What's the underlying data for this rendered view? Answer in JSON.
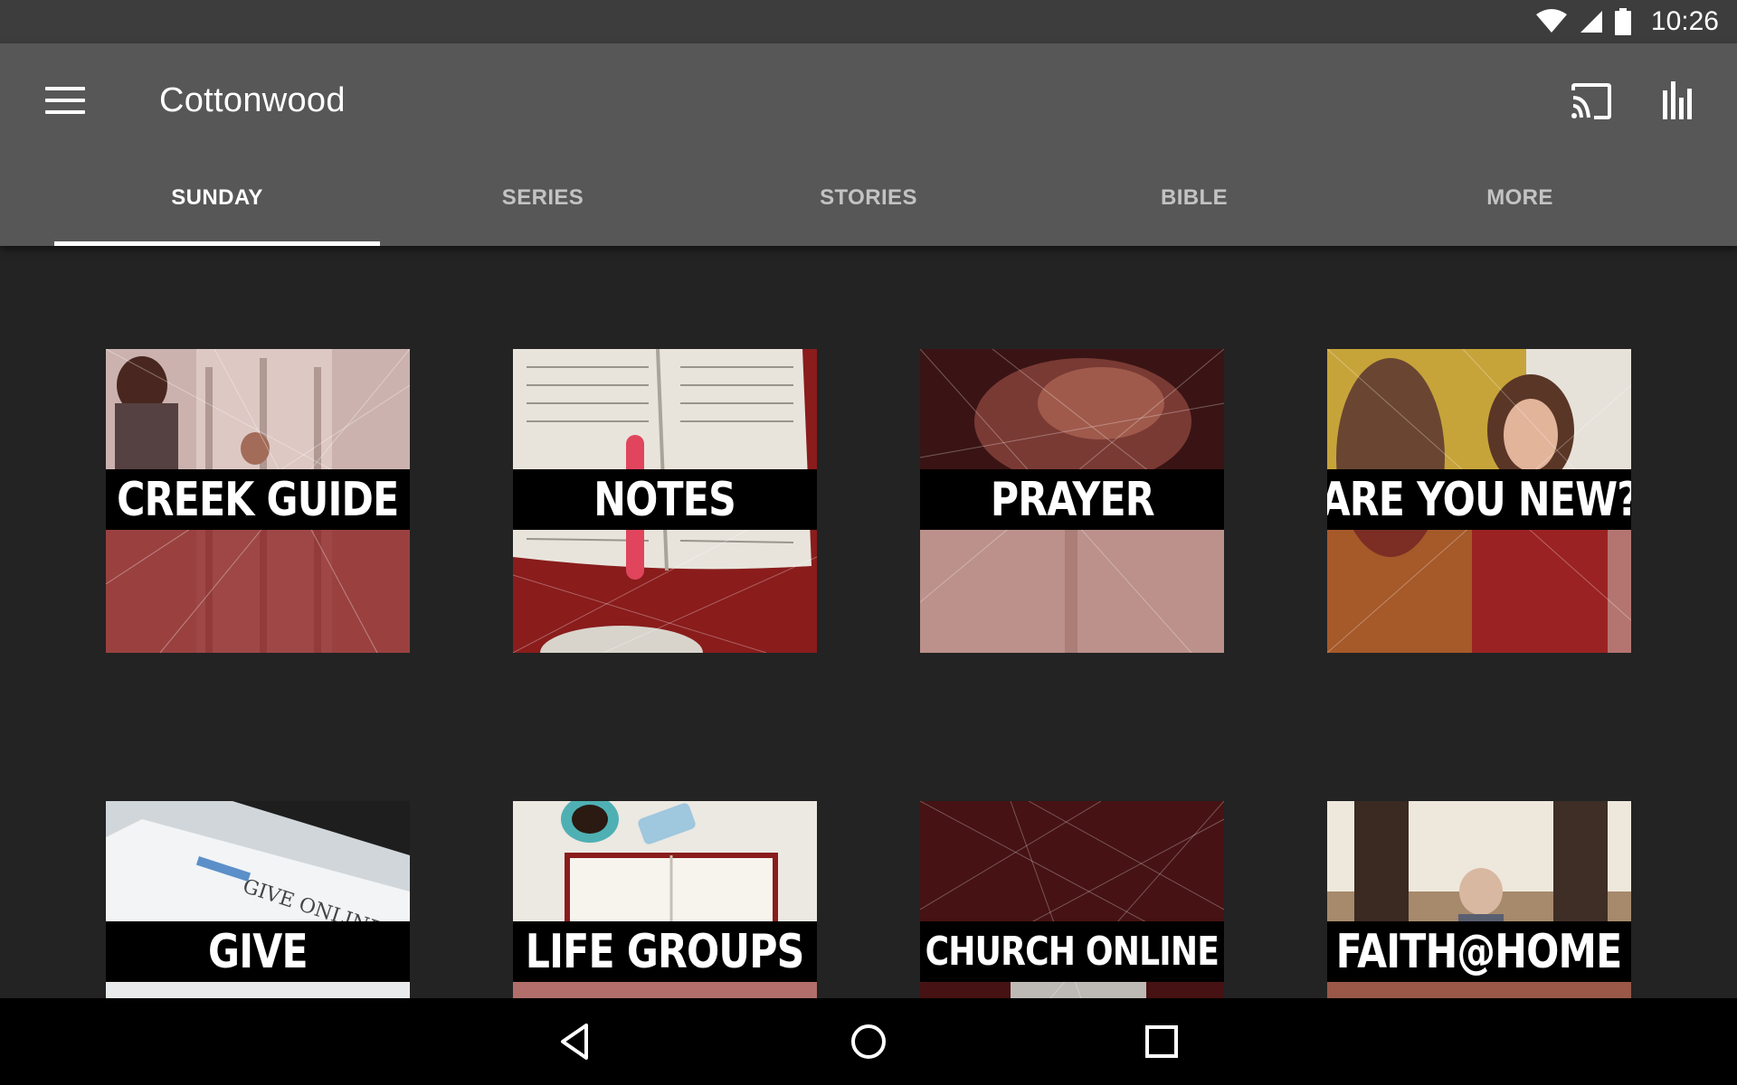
{
  "status_bar": {
    "time": "10:26",
    "icons": [
      "wifi-icon",
      "cell-signal-icon",
      "battery-icon"
    ]
  },
  "app_bar": {
    "title": "Cottonwood",
    "icons": [
      "menu-icon",
      "cast-icon",
      "bar-chart-icon"
    ]
  },
  "tabs": [
    {
      "label": "SUNDAY",
      "active": true
    },
    {
      "label": "SERIES",
      "active": false
    },
    {
      "label": "STORIES",
      "active": false
    },
    {
      "label": "BIBLE",
      "active": false
    },
    {
      "label": "MORE",
      "active": false
    }
  ],
  "tiles": [
    {
      "label": "CREEK GUIDE"
    },
    {
      "label": "NOTES"
    },
    {
      "label": "PRAYER"
    },
    {
      "label": "ARE YOU NEW?"
    },
    {
      "label": "GIVE"
    },
    {
      "label": "LIFE GROUPS"
    },
    {
      "label": "CHURCH ONLINE"
    },
    {
      "label": "FAITH@HOME"
    }
  ],
  "nav_bar": {
    "icons": [
      "back-icon",
      "home-icon",
      "recents-icon"
    ]
  },
  "colors": {
    "app_bar": "#575757",
    "status_bar": "#3d3d3d",
    "background": "#232323",
    "tile_tint": "#8a1c1c"
  }
}
